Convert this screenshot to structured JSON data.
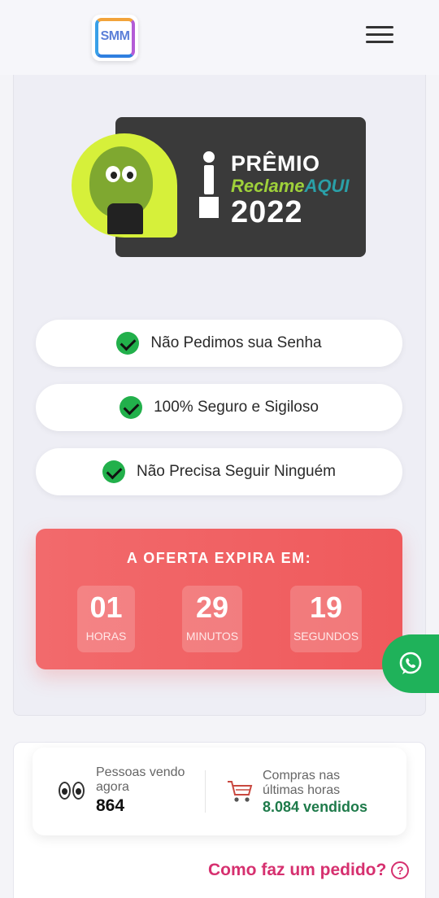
{
  "header": {
    "logo_text": "SMM",
    "menu_icon": "hamburger-menu-icon"
  },
  "award": {
    "title": "PRÊMIO",
    "brand_reclame": "Reclame",
    "brand_aqui": "AQUI",
    "year": "2022"
  },
  "features": [
    {
      "label": "Não Pedimos sua Senha",
      "icon": "check-circle-icon"
    },
    {
      "label": "100% Seguro e Sigiloso",
      "icon": "check-circle-icon"
    },
    {
      "label": "Não Precisa Seguir Ninguém",
      "icon": "check-circle-icon"
    }
  ],
  "offer": {
    "title": "A OFERTA EXPIRA EM:",
    "hours": "01",
    "hours_label": "HORAS",
    "minutes": "29",
    "minutes_label": "MINUTOS",
    "seconds": "19",
    "seconds_label": "SEGUNDOS"
  },
  "stats": {
    "viewing_label": "Pessoas vendo agora",
    "viewing_count": "864",
    "purchases_label": "Compras nas últimas horas",
    "purchases_value": "8.084 vendidos"
  },
  "howto": {
    "label": "Como faz um pedido?",
    "icon": "question-circle-icon"
  },
  "colors": {
    "accent_red": "#ef5a5c",
    "success_green": "#22b04b",
    "whatsapp_green": "#1fb25a",
    "link_pink": "#d6306f"
  }
}
